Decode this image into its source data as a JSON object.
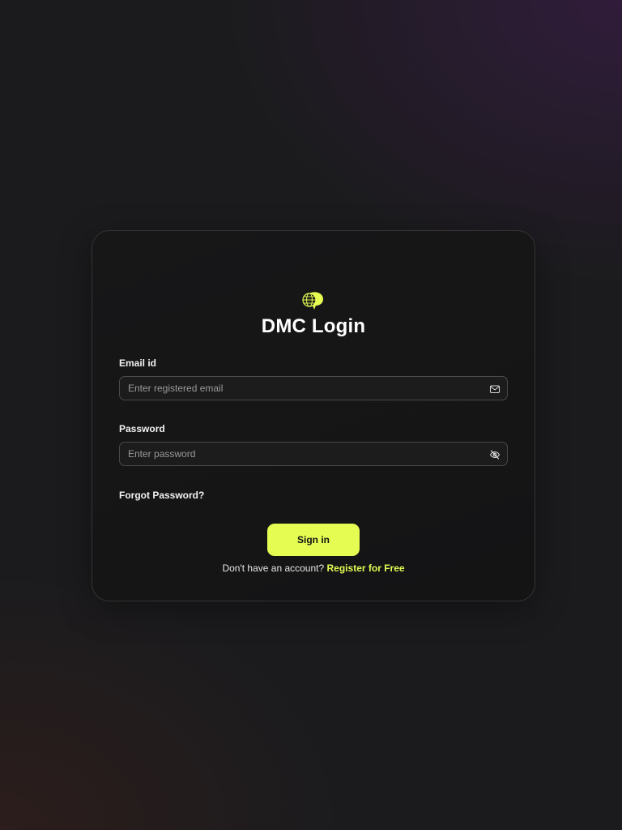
{
  "app": {
    "title": "DMC Login",
    "accent_color": "#e5fc52",
    "logo_icon": "globe-chat-icon"
  },
  "form": {
    "email": {
      "label": "Email id",
      "placeholder": "Enter registered email",
      "value": "",
      "icon": "mail-icon"
    },
    "password": {
      "label": "Password",
      "placeholder": "Enter password",
      "value": "",
      "icon": "eye-off-icon"
    },
    "forgot_label": "Forgot Password?",
    "submit_label": "Sign in"
  },
  "footer": {
    "prompt": "Don't have an account?",
    "register_label": "Register for Free"
  }
}
